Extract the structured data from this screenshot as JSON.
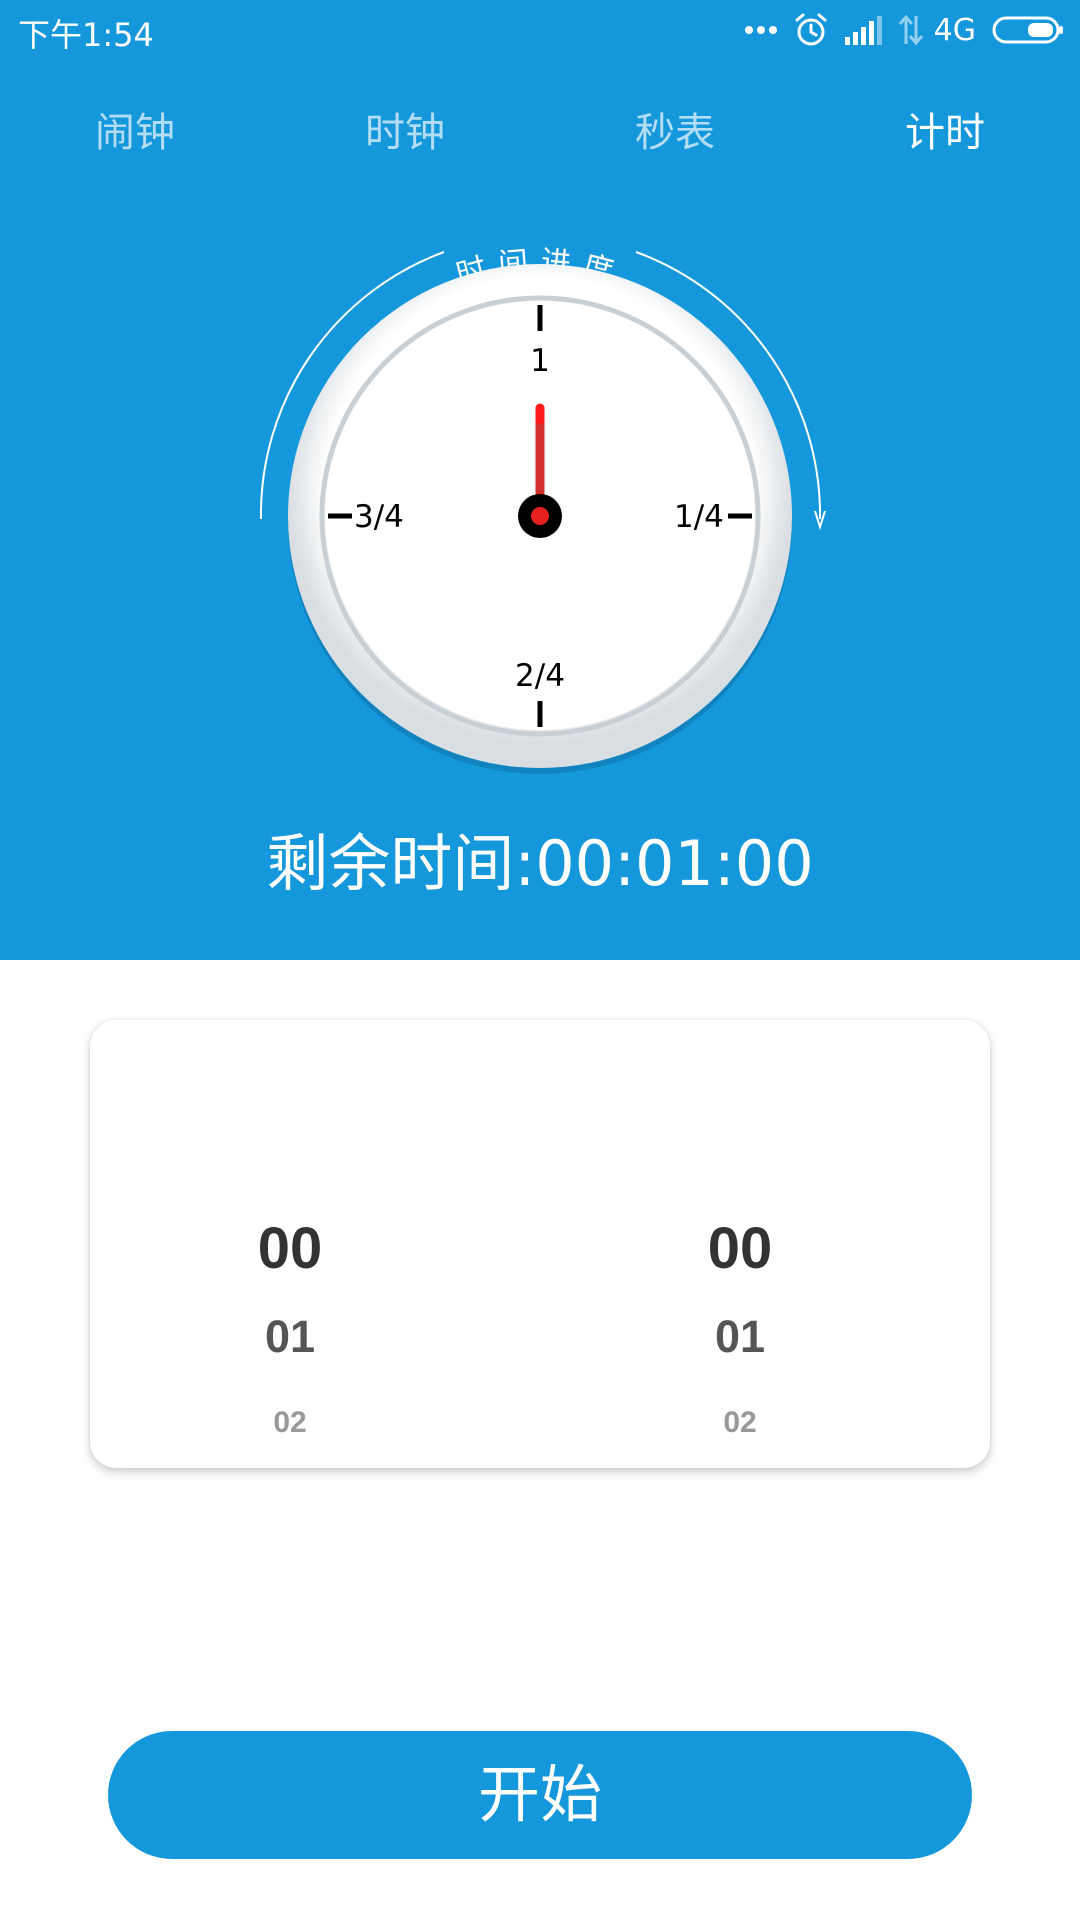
{
  "status_bar": {
    "time": "下午1:54",
    "network": "4G",
    "icons": [
      "more-dots-icon",
      "alarm-clock-icon",
      "signal-icon",
      "data-arrows-icon",
      "battery-icon"
    ]
  },
  "tabs": [
    {
      "label": "闹钟",
      "active": false
    },
    {
      "label": "时钟",
      "active": false
    },
    {
      "label": "秒表",
      "active": false
    },
    {
      "label": "计时",
      "active": true
    }
  ],
  "dial": {
    "arc_label": "时间进度",
    "marks": {
      "top": "1",
      "right": "1/4",
      "bottom": "2/4",
      "left": "3/4"
    },
    "progress": 0
  },
  "remaining": {
    "text": "剩余时间:00:01:00"
  },
  "picker": {
    "left": [
      "00",
      "01",
      "02"
    ],
    "right": [
      "00",
      "01",
      "02"
    ]
  },
  "start_button": {
    "label": "开始"
  },
  "colors": {
    "primary": "#1497DB",
    "hand": "#D32F2F",
    "hand_tip": "#FF1A1A",
    "text_dark": "#333333"
  }
}
